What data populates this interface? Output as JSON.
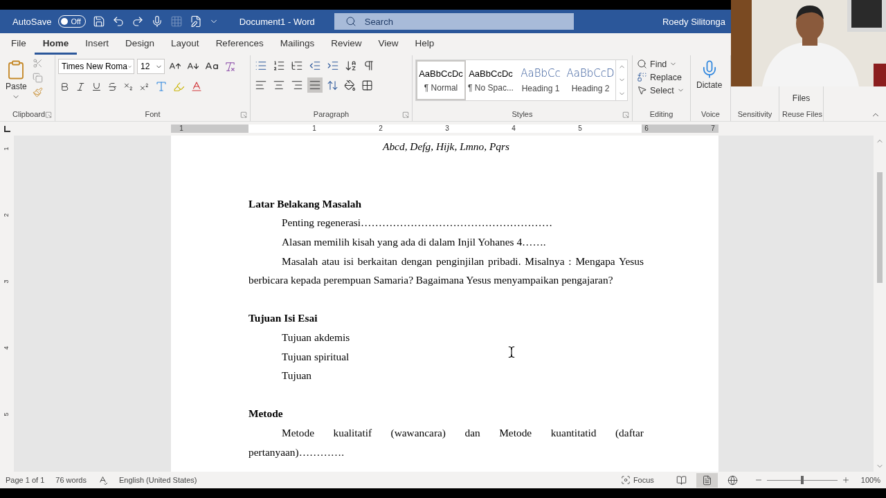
{
  "title_bar": {
    "autosave_label": "AutoSave",
    "autosave": {
      "on": false,
      "label": "Off"
    },
    "title": "Document1  -  Word",
    "search": {
      "placeholder": "Search"
    },
    "user": "Roedy Silitonga"
  },
  "tabs": [
    {
      "label": "File",
      "selected": false
    },
    {
      "label": "Home",
      "selected": true
    },
    {
      "label": "Insert",
      "selected": false
    },
    {
      "label": "Design",
      "selected": false
    },
    {
      "label": "Layout",
      "selected": false
    },
    {
      "label": "References",
      "selected": false
    },
    {
      "label": "Mailings",
      "selected": false
    },
    {
      "label": "Review",
      "selected": false
    },
    {
      "label": "View",
      "selected": false
    },
    {
      "label": "Help",
      "selected": false
    }
  ],
  "ribbon": {
    "clipboard": {
      "paste": "Paste",
      "label": "Clipboard"
    },
    "font": {
      "name": "Times New Roma",
      "size": "12",
      "label": "Font"
    },
    "paragraph": {
      "alignment": [
        {
          "selected": false
        },
        {
          "selected": false
        },
        {
          "selected": false
        },
        {
          "selected": true
        }
      ],
      "label": "Paragraph"
    },
    "styles": {
      "items": [
        {
          "preview": "AaBbCcDc",
          "name": "¶ Normal",
          "kind": "body",
          "selected": true
        },
        {
          "preview": "AaBbCcDc",
          "name": "¶ No Spac...",
          "kind": "body",
          "selected": false
        },
        {
          "preview": "AaBbCc",
          "name": "Heading 1",
          "kind": "heading",
          "selected": false
        },
        {
          "preview": "AaBbCcD",
          "name": "Heading 2",
          "kind": "heading",
          "selected": false
        }
      ],
      "label": "Styles"
    },
    "editing": {
      "find": "Find",
      "replace": "Replace",
      "select": "Select",
      "label": "Editing"
    },
    "voice": {
      "dictate": "Dictate",
      "label": "Voice"
    },
    "sensitivity": {
      "label": "Sensitivity"
    },
    "reuse": {
      "button": "Files",
      "label": "Reuse Files"
    }
  },
  "ruler": {
    "numbers": [
      "1",
      "1",
      "2",
      "3",
      "4",
      "5",
      "6",
      "7"
    ]
  },
  "vertical_ruler": {
    "numbers": [
      "1",
      "2",
      "3",
      "4",
      "5"
    ]
  },
  "document": {
    "blocks": [
      {
        "kind": "title",
        "text": "Abcd, Defg, Hijk, Lmno, Pqrs"
      },
      {
        "kind": "blank"
      },
      {
        "kind": "blank"
      },
      {
        "kind": "heading",
        "text": "Latar Belakang Masalah"
      },
      {
        "kind": "item",
        "text": "Penting regenerasi………………………………………………"
      },
      {
        "kind": "item",
        "text": "Alasan memilih kisah yang ada di dalam Injil Yohanes 4……."
      },
      {
        "kind": "paragraph",
        "text": "Masalah atau isi berkaitan dengan penginjilan pribadi. Misalnya : Mengapa Yesus berbicara kepada perempuan Samaria? Bagaimana Yesus menyampaikan pengajaran?"
      },
      {
        "kind": "blank"
      },
      {
        "kind": "heading",
        "text": "Tujuan Isi Esai"
      },
      {
        "kind": "item",
        "text": "Tujuan akdemis"
      },
      {
        "kind": "item",
        "text": "Tujuan spiritual"
      },
      {
        "kind": "item",
        "text": "Tujuan"
      },
      {
        "kind": "blank"
      },
      {
        "kind": "heading",
        "text": "Metode"
      },
      {
        "kind": "paragraph",
        "text": "Metode kualitatif (wawancara) dan Metode kuantitatid (daftar pertanyaan)…………."
      }
    ]
  },
  "status_bar": {
    "page": "Page 1 of 1",
    "words": "76 words",
    "language": "English (United States)",
    "focus": "Focus",
    "views": [
      {
        "selected": false
      },
      {
        "selected": true
      },
      {
        "selected": false
      }
    ],
    "zoom": {
      "level": 0.5,
      "label": "100%"
    }
  }
}
